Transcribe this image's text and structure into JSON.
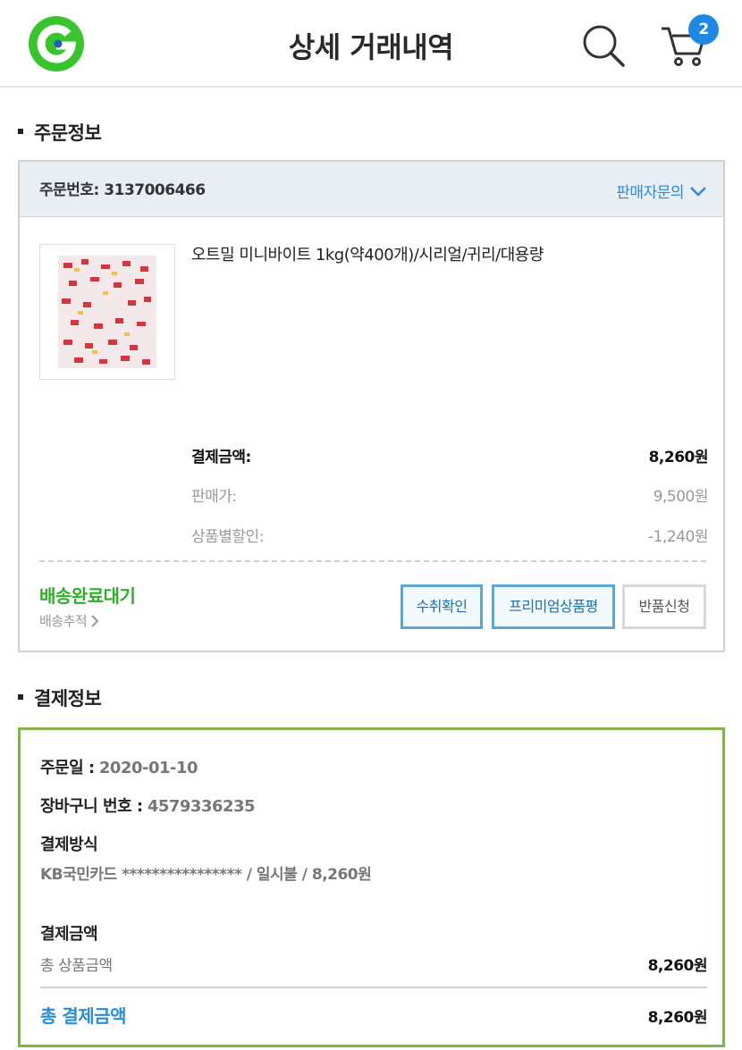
{
  "header": {
    "title": "상세 거래내역",
    "cart_count": "2",
    "logo_icon": "gmarket-logo",
    "accent": "#38c42d"
  },
  "order_section": {
    "title": "주문정보",
    "order_no_label": "주문번호:",
    "order_no": "3137006466",
    "seller_inquiry": "판매자문의",
    "product_name": "오트밀 미니바이트 1kg(약400개)/시리얼/귀리/대용량",
    "payment_label": "결제금액:",
    "payment_value": "8,260원",
    "sale_price_label": "판매가:",
    "sale_price_value": "9,500원",
    "discount_label": "상품별할인:",
    "discount_value": "-1,240원",
    "status": "배송완료대기",
    "tracking": "배송추적",
    "buttons": {
      "confirm": "수취확인",
      "premium_review": "프리미엄상품평",
      "return": "반품신청"
    }
  },
  "payment_section": {
    "title": "결제정보",
    "order_date_label": "주문일 :",
    "order_date": "2020-01-10",
    "cart_no_label": "장바구니 번호 :",
    "cart_no": "4579336235",
    "method_label": "결제방식",
    "method_value": "KB국민카드 **************** / 일시불 / 8,260원",
    "amount_label": "결제금액",
    "total_goods_label": "총 상품금액",
    "total_goods_value": "8,260원",
    "total_payment_label": "총 결제금액",
    "total_payment_value": "8,260원"
  }
}
